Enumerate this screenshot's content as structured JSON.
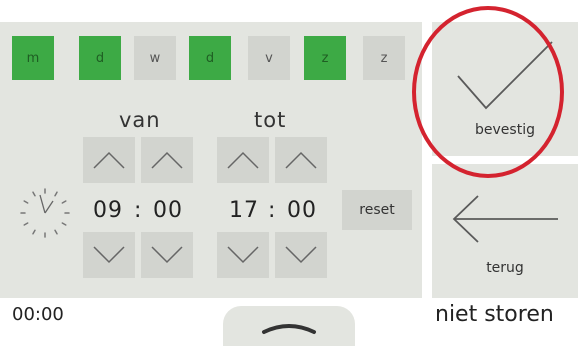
{
  "days": [
    "m",
    "d",
    "w",
    "d",
    "v",
    "z",
    "z"
  ],
  "days_active": [
    true,
    true,
    false,
    true,
    false,
    true,
    false
  ],
  "schedule": {
    "from_label": "van",
    "to_label": "tot",
    "from_hour": "09",
    "from_minute": "00",
    "to_hour": "17",
    "to_minute": "00",
    "separator": ":"
  },
  "reset_label": "reset",
  "confirm_label": "bevestig",
  "back_label": "terug",
  "status": {
    "clock": "00:00",
    "mode_title": "niet storen"
  },
  "icons": {
    "clock": "clock-icon",
    "up": "chevron-up-icon",
    "down": "chevron-down-icon",
    "confirm": "checkmark-icon",
    "back": "arrow-left-icon",
    "tab": "chevron-up-icon"
  },
  "colors": {
    "active_day": "#3daa45",
    "inactive_day": "#d2d4cf",
    "panel": "#e3e5e0",
    "highlight_ring": "#d4232f"
  }
}
